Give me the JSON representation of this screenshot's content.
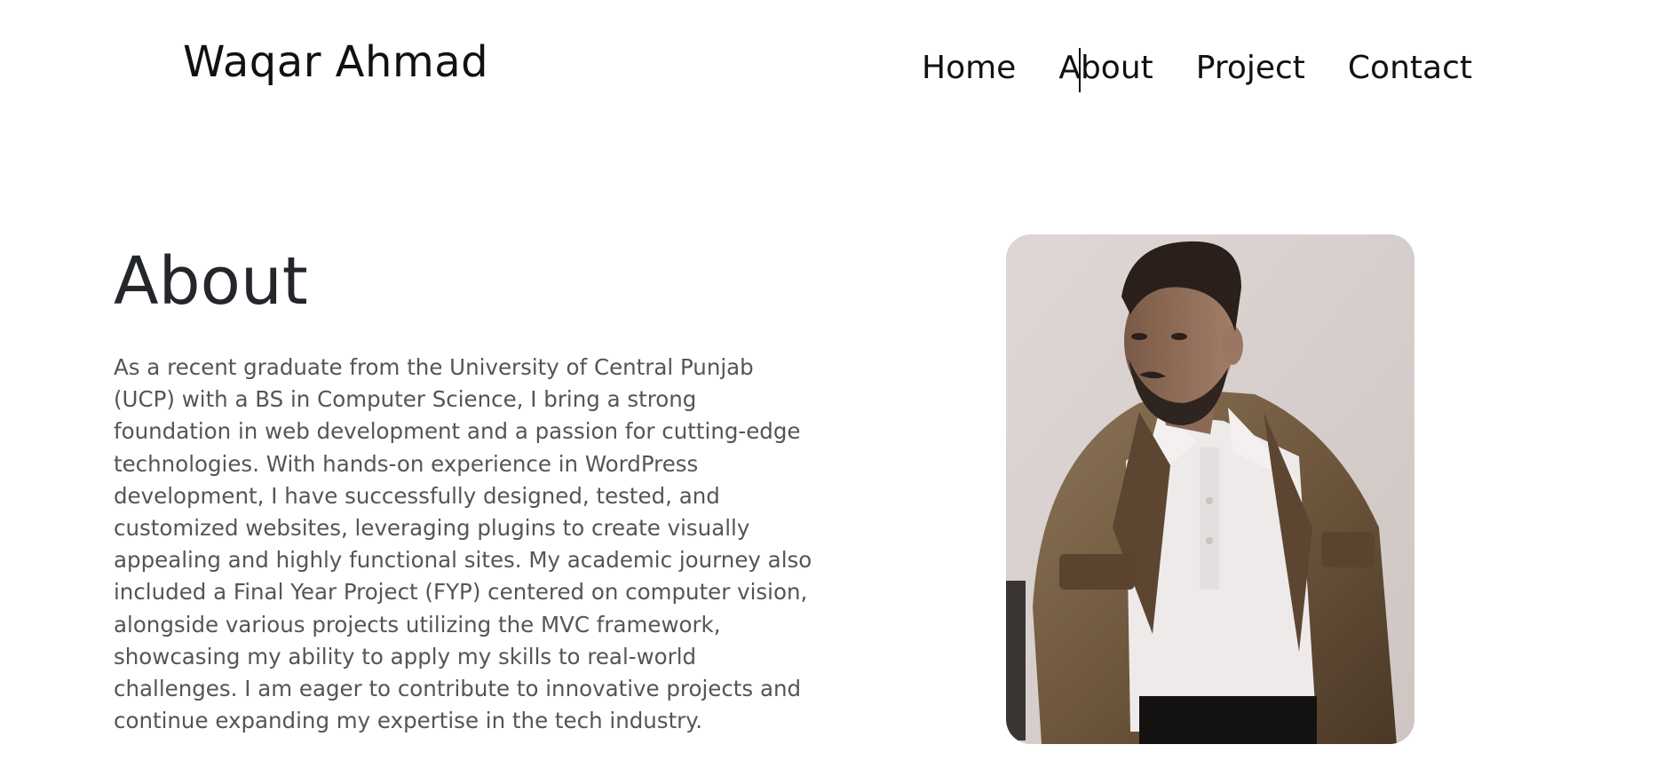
{
  "header": {
    "brand": "Waqar Ahmad",
    "nav": {
      "home": "Home",
      "about": "About",
      "project": "Project",
      "contact": "Contact"
    }
  },
  "about": {
    "title": "About",
    "body": "As a recent graduate from the University of Central Punjab (UCP) with a BS in Computer Science, I bring a strong foundation in web development and a passion for cutting-edge technologies. With hands-on experience in WordPress development, I have successfully designed, tested, and customized websites, leveraging plugins to create visually appealing and highly functional sites. My academic journey also included a Final Year Project (FYP) centered on computer vision, alongside various projects utilizing the MVC framework, showcasing my ability to apply my skills to real-world challenges. I am eager to contribute to innovative projects and continue expanding my expertise in the tech industry."
  },
  "colors": {
    "text": "#111111",
    "heading": "#23262b",
    "body_text": "#555555",
    "background": "#ffffff"
  }
}
